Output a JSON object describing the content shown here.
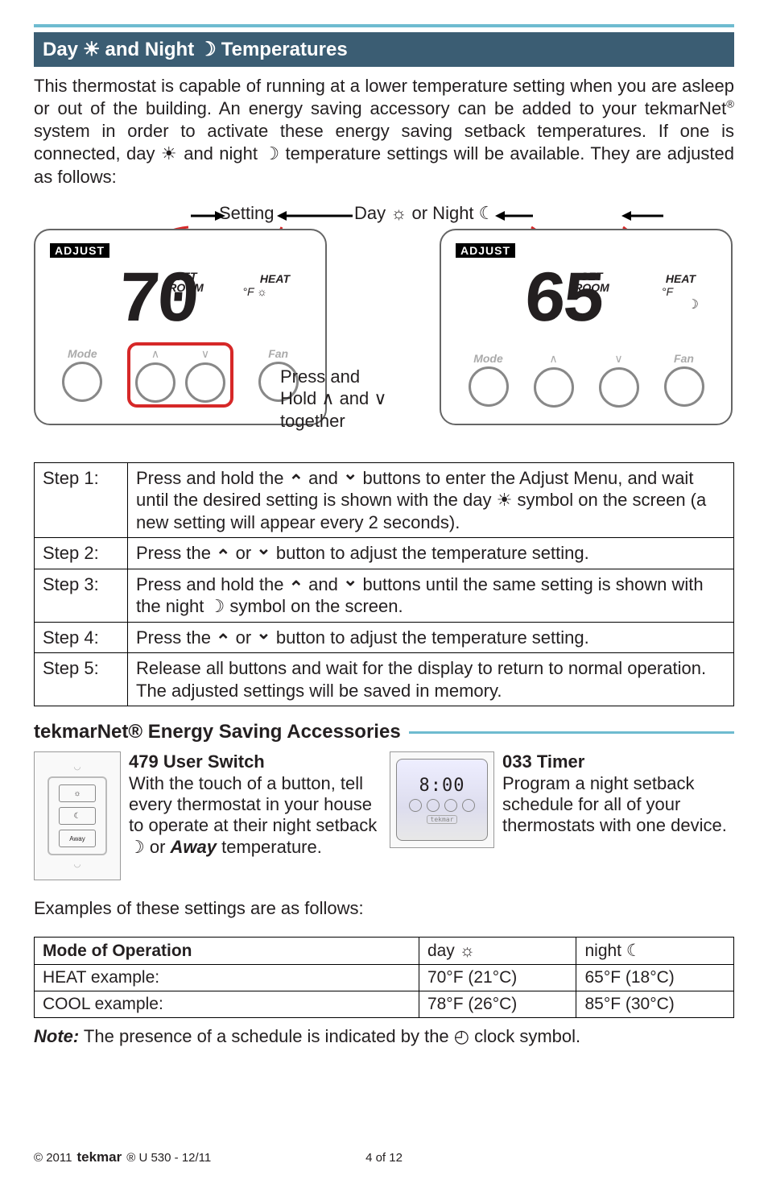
{
  "header": {
    "title_pre": "Day",
    "title_mid": "and Night",
    "title_post": "Temperatures"
  },
  "intro": {
    "p1": "This thermostat is capable of running at a lower temperature setting when you are asleep or out of the building. An energy saving accessory can be added to your tekmarNet",
    "p1b": " system in order to activate these energy saving setback temperatures. If one is connected, day ",
    "p1c": " and night ",
    "p1d": " temperature settings will be available. They are adjusted as follows:"
  },
  "diagram": {
    "setting": "Setting",
    "dayornight": "Day ☼ or Night ☾",
    "adjust": "ADJUST",
    "setroom1": "SET",
    "setroom2": "ROOM",
    "heat": "HEAT",
    "degf": "°F ☼",
    "degf_n": "°F",
    "val_day": "70",
    "val_night": "65",
    "mode": "Mode",
    "fan": "Fan",
    "press_hold1": "Press and",
    "press_hold2": "Hold ∧ and ∨",
    "press_hold3": "together"
  },
  "steps": [
    {
      "label": "Step 1:",
      "text_a": "Press and hold the ",
      "text_b": " and ",
      "text_c": " buttons to enter the Adjust Menu, and wait until the desired setting is shown with the day ",
      "text_d": " symbol on the screen (a new setting will appear every 2 seconds)."
    },
    {
      "label": "Step 2:",
      "text_a": "Press the ",
      "text_b": " or ",
      "text_c": " button to adjust the temperature setting.",
      "text_d": ""
    },
    {
      "label": "Step 3:",
      "text_a": "Press and hold the ",
      "text_b": " and ",
      "text_c": " buttons until the same setting is shown with the night ",
      "text_d": " symbol on the screen."
    },
    {
      "label": "Step 4:",
      "text_a": "Press the ",
      "text_b": " or ",
      "text_c": " button to adjust the temperature setting.",
      "text_d": ""
    },
    {
      "label": "Step 5:",
      "text_a": "Release all buttons and wait for the display to return to normal operation. The adjusted settings will be saved in memory.",
      "text_b": "",
      "text_c": "",
      "text_d": ""
    }
  ],
  "subhead": "tekmarNet® Energy Saving Accessories",
  "acc": {
    "left_title": "479 User Switch",
    "left_body_a": "With the touch of a button, tell every thermostat in your house to operate at their night setback ",
    "left_body_b": " or ",
    "left_away": "Away",
    "left_body_c": " temperature.",
    "right_title": "033 Timer",
    "right_body": "Program a night setback schedule for all of your thermostats with one device.",
    "timer_disp": "8:00",
    "switch_away": "Away"
  },
  "examples_intro": "Examples of these settings are as follows:",
  "ex_table": {
    "h1": "Mode of Operation",
    "h2": "day ☼",
    "h3": "night ☾",
    "r1c1": "HEAT example:",
    "r1c2": "70°F (21°C)",
    "r1c3": "65°F (18°C)",
    "r2c1": "COOL example:",
    "r2c2": "78°F (26°C)",
    "r2c3": "85°F (30°C)"
  },
  "note": {
    "bold": "Note:",
    "text_a": " The presence of a schedule is indicated by the ",
    "text_b": " clock symbol."
  },
  "footer": {
    "copyright": "© 2011",
    "brand": "tekmar",
    "suffix": "®  U 530 - 12/11",
    "page": "4 of 12"
  }
}
